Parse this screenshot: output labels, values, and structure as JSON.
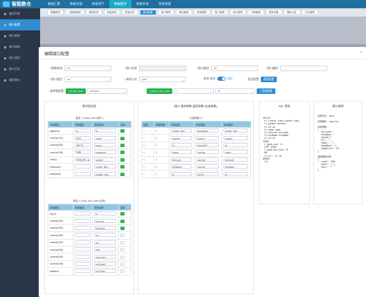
{
  "app": {
    "name": "智能数仓"
  },
  "topnav": [
    "数据汇聚",
    "数据治理",
    "数据资产",
    "数据服务",
    "数据开发",
    "系统管理"
  ],
  "topnav_active": 3,
  "sidebar": [
    "服务列表",
    "接口配置",
    "接口审核",
    "接口授权",
    "接口调试",
    "接口日志",
    "服务统计"
  ],
  "sidebar_active": 1,
  "tabs": [
    "数据概览",
    "元数据管理",
    "数据标准",
    "质量规则",
    "质量任务",
    "接口配置",
    "用户管理",
    "角色管理",
    "菜单管理",
    "部门管理",
    "岗位管理",
    "字典管理",
    "参数设置",
    "通知公告",
    "日志管理"
  ],
  "tab_active": 5,
  "modal": {
    "title": "编辑接口配置",
    "close": "×",
    "fields": {
      "data_source": {
        "label": "* 数据来源",
        "value": "oa"
      },
      "interface_name": {
        "label": "* 接口名称",
        "value": ""
      },
      "interface_path": {
        "label": "* 接口路径",
        "value": "oa"
      },
      "interface_code": {
        "label": "* 接口编码",
        "value": ""
      },
      "interface_type": {
        "label": "* 接口类型",
        "value": "oa"
      },
      "request_method": {
        "label": "* 请求方式",
        "value": "post"
      },
      "status": {
        "label": "状态 启用",
        "value": "启用"
      },
      "sql_config": {
        "label": "是否配置",
        "button": "预设配置"
      }
    },
    "join": {
      "label": "选择表配置",
      "left_table": "t_book_user",
      "left_field": "set.json",
      "right_table": "t_book_bus_user",
      "op": "=",
      "right_field": "id",
      "add_button": "+ 添加配置"
    }
  },
  "panels": {
    "table_fields": {
      "title": "表字段信息",
      "t1_title": "表名: t_book_user (用户)",
      "t1_headers": [
        "字段类型",
        "字段描述",
        "字段名称",
        "选择"
      ],
      "t1_rows": [
        [
          "bigint(20)",
          "id",
          "id",
          true
        ],
        [
          "varchar(100)",
          "姓名",
          "name",
          true
        ],
        [
          "varchar(255)",
          "用户名",
          "name",
          true
        ],
        [
          "varchar(255)",
          "密码",
          "password",
          true
        ],
        [
          "char(1)",
          "性别(0男 1女)",
          "gender",
          true
        ],
        [
          "timestamp",
          "",
          "create_time",
          true
        ],
        [
          "timestamp",
          "",
          "update_time",
          true
        ]
      ],
      "t2_title": "表名: t_book_bus_user (业务)",
      "t2_headers": [
        "字段类型",
        "字段描述",
        "字段名称",
        "选择"
      ],
      "t2_rows": [
        [
          "int(11)",
          "",
          "id",
          true
        ],
        [
          "varchar(255)",
          "",
          "bizCode",
          true
        ],
        [
          "varchar(255)",
          "",
          "bizName",
          true
        ],
        [
          "varchar(255)",
          "",
          "ty1",
          false
        ],
        [
          "varchar(255)",
          "",
          "ty2",
          false
        ],
        [
          "varchar(255)",
          "",
          "ext1",
          false
        ],
        [
          "varchar(255)",
          "",
          "extCode1",
          false
        ],
        [
          "varchar(255)",
          "",
          "extCode2",
          false
        ],
        [
          "datetime",
          "",
          "extTime1",
          false
        ]
      ]
    },
    "field_params": {
      "title": "接口 请求参数 返回参数 (勾选参数)",
      "sub": "已选参数: 8",
      "headers": [
        "参数",
        "请求参数",
        "字段名称",
        "字段类型",
        "字段描述"
      ],
      "rows": [
        [
          "<",
          "1",
          "create_time",
          "timestamp",
          "create_time"
        ],
        [
          "<",
          "1",
          "gender",
          "char(1)",
          "gender"
        ],
        [
          "<",
          "1",
          "id",
          "bigint(20)",
          "id"
        ],
        [
          "<",
          "1",
          "name",
          "varchar",
          "name"
        ],
        [
          "<",
          "1",
          "bizCode",
          "varchar",
          "bizCode"
        ],
        [
          "<",
          "1",
          "bizName",
          "varchar",
          "bizName"
        ],
        [
          "<",
          "1",
          "id",
          "int(11)",
          "id"
        ]
      ]
    },
    "sql_preview": {
      "title": "SQL 预览",
      "code": "SELECT\n t1.create_time,create_time,\n t1.gender gender,\n t1.id id,\n t1.name name,\n t2.bizCode bizCode,\n t2.bizName bizName,\n t2.id id\nFROM\n t_book_user t1\n LEFT JOIN\n t_book_bus_user t2\n ON\n t1.id = t2.id\nWHERE\n 1=1"
    },
    "api_doc": {
      "title": "接口说明",
      "code": "请求方式: post\n\n请求路径: /api/oa\n\n请求参数:\n{\n  \"bizCode\":\n  \"bizName\":\n  \"gender\":\n  \"id\": \"\",\n  \"name\": \"\",\n  \"pageNum\": 1,\n  \"pageSize\": 10\n}\n\n返回参数示例:\n{\n  \"code\": 200,\n  \"data\": [ ],\n  \"msg\": \"\"\n}"
    }
  }
}
